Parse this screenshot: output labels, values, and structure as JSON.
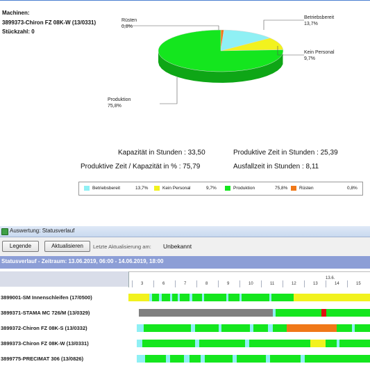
{
  "machine_info": {
    "heading": "Machinen:",
    "machine": "3899373-Chiron FZ 08K-W (13/0331)",
    "count_label": "Stückzahl: 0"
  },
  "pie": {
    "slices": [
      {
        "name": "Betriebsbereit",
        "value": 13.7,
        "value_label": "13,7%",
        "color": "#8ff0f4"
      },
      {
        "name": "Kein Personal",
        "value": 9.7,
        "value_label": "9,7%",
        "color": "#f2f21e"
      },
      {
        "name": "Produktion",
        "value": 75.8,
        "value_label": "75,8%",
        "color": "#14e61e"
      },
      {
        "name": "Rüsten",
        "value": 0.8,
        "value_label": "0,8%",
        "color": "#f07818"
      }
    ]
  },
  "kpis": {
    "capacity": "Kapazität in Stunden : 33,50",
    "productive_time": "Produktive Zeit in Stunden : 25,39",
    "productive_ratio": "Produktive Zeit / Kapazität in % : 75,79",
    "downtime": "Ausfallzeit in Stunden : 8,11"
  },
  "legend": [
    {
      "name": "Betriebsbereit",
      "value": "13,7%",
      "color": "#8ff0f4"
    },
    {
      "name": "Kein Personal",
      "value": "9,7%",
      "color": "#f2f21e"
    },
    {
      "name": "Produktion",
      "value": "75,8%",
      "color": "#14e61e"
    },
    {
      "name": "Rüsten",
      "value": "0,8%",
      "color": "#f07818"
    }
  ],
  "window": {
    "title": "Auswertung: Statusverlauf",
    "legend_button": "Legende",
    "refresh_button": "Aktualisieren",
    "last_update_label": "Letzte Aktualisierung am:",
    "last_update_value": "Unbekannt",
    "period": "Statusverlauf - Zeitraum: 13.06.2019, 06:00 - 14.06.2019, 18:00"
  },
  "timeline": {
    "day_label": "13.6.",
    "hours": [
      "3",
      "6",
      "7",
      "8",
      "9",
      "10",
      "11",
      "12",
      "13",
      "14",
      "15"
    ],
    "rows": [
      {
        "label": "3899001-SM Innenschleifen (17/0500)",
        "segments": [
          [
            "#f2f21e",
            0,
            30
          ],
          [
            "#8ff0f4",
            30,
            34
          ],
          [
            "#14e61e",
            34,
            44
          ],
          [
            "#8ff0f4",
            44,
            48
          ],
          [
            "#14e61e",
            48,
            60
          ],
          [
            "#8ff0f4",
            60,
            63
          ],
          [
            "#14e61e",
            63,
            71
          ],
          [
            "#8ff0f4",
            71,
            74
          ],
          [
            "#14e61e",
            74,
            88
          ],
          [
            "#8ff0f4",
            88,
            92
          ],
          [
            "#14e61e",
            92,
            106
          ],
          [
            "#8ff0f4",
            106,
            109
          ],
          [
            "#14e61e",
            109,
            141
          ],
          [
            "#8ff0f4",
            141,
            144
          ],
          [
            "#14e61e",
            144,
            160
          ],
          [
            "#8ff0f4",
            160,
            163
          ],
          [
            "#14e61e",
            163,
            203
          ],
          [
            "#8ff0f4",
            203,
            206
          ],
          [
            "#14e61e",
            206,
            238
          ],
          [
            "#f2f21e",
            238,
            348
          ]
        ]
      },
      {
        "label": "3899371-STAMA MC 726/M (13/0329)",
        "segments": [
          [
            "#808080",
            15,
            208
          ],
          [
            "#8ff0f4",
            208,
            212
          ],
          [
            "#14e61e",
            212,
            278
          ],
          [
            "#e01010",
            278,
            285
          ],
          [
            "#14e61e",
            285,
            348
          ]
        ]
      },
      {
        "label": "3899372-Chiron FZ 08K-S (13/0332)",
        "segments": [
          [
            "#8ff0f4",
            12,
            22
          ],
          [
            "#14e61e",
            22,
            90
          ],
          [
            "#8ff0f4",
            90,
            96
          ],
          [
            "#14e61e",
            96,
            130
          ],
          [
            "#8ff0f4",
            130,
            134
          ],
          [
            "#14e61e",
            134,
            175
          ],
          [
            "#8ff0f4",
            175,
            180
          ],
          [
            "#14e61e",
            180,
            201
          ],
          [
            "#8ff0f4",
            201,
            208
          ],
          [
            "#14e61e",
            208,
            228
          ],
          [
            "#f07818",
            228,
            300
          ],
          [
            "#14e61e",
            300,
            322
          ],
          [
            "#8ff0f4",
            322,
            326
          ],
          [
            "#14e61e",
            326,
            348
          ]
        ]
      },
      {
        "label": "3899373-Chiron FZ 08K-W (13/0331)",
        "segments": [
          [
            "#8ff0f4",
            12,
            20
          ],
          [
            "#14e61e",
            20,
            96
          ],
          [
            "#8ff0f4",
            96,
            102
          ],
          [
            "#14e61e",
            102,
            168
          ],
          [
            "#8ff0f4",
            168,
            174
          ],
          [
            "#14e61e",
            174,
            262
          ],
          [
            "#f2f21e",
            262,
            284
          ],
          [
            "#14e61e",
            284,
            300
          ],
          [
            "#8ff0f4",
            300,
            304
          ],
          [
            "#14e61e",
            304,
            348
          ]
        ]
      },
      {
        "label": "3899775-PRECIMAT 306 (13/0826)",
        "segments": [
          [
            "#8ff0f4",
            12,
            24
          ],
          [
            "#14e61e",
            24,
            54
          ],
          [
            "#8ff0f4",
            54,
            60
          ],
          [
            "#14e61e",
            60,
            80
          ],
          [
            "#8ff0f4",
            80,
            88
          ],
          [
            "#14e61e",
            88,
            104
          ],
          [
            "#8ff0f4",
            104,
            110
          ],
          [
            "#14e61e",
            110,
            150
          ],
          [
            "#8ff0f4",
            150,
            156
          ],
          [
            "#14e61e",
            156,
            198
          ],
          [
            "#8ff0f4",
            198,
            204
          ],
          [
            "#14e61e",
            204,
            248
          ],
          [
            "#8ff0f4",
            248,
            254
          ],
          [
            "#14e61e",
            254,
            348
          ]
        ]
      }
    ]
  }
}
